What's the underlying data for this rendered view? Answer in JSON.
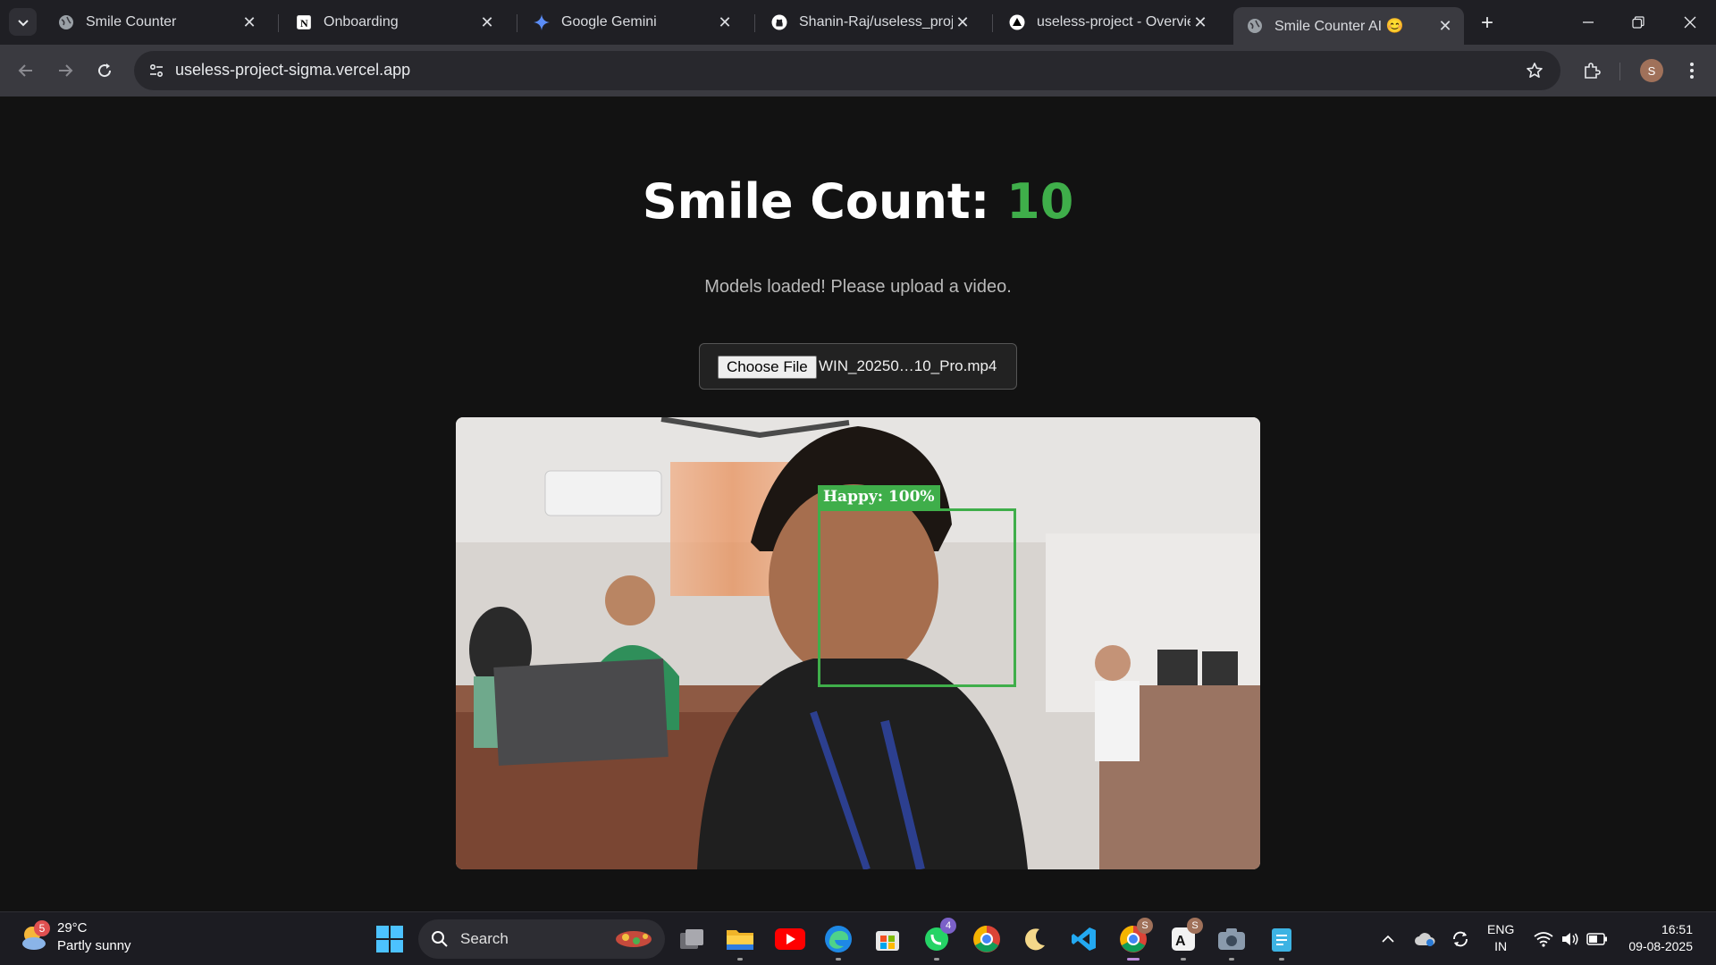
{
  "browser": {
    "tabs": [
      {
        "title": "Smile Counter",
        "icon": "globe-icon"
      },
      {
        "title": "Onboarding",
        "icon": "notion-icon"
      },
      {
        "title": "Google Gemini",
        "icon": "gemini-icon"
      },
      {
        "title": "Shanin-Raj/useless_project",
        "icon": "github-icon"
      },
      {
        "title": "useless-project - Overview",
        "icon": "vercel-icon"
      },
      {
        "title": "Smile Counter AI 😊",
        "icon": "globe-icon",
        "active": true
      }
    ],
    "url": "useless-project-sigma.vercel.app",
    "profile_initial": "S"
  },
  "page": {
    "heading_label": "Smile Count:",
    "smile_count": "10",
    "status": "Models loaded! Please upload a video.",
    "file_input": {
      "button_label": "Choose File",
      "file_name": "WIN_20250…10_Pro.mp4"
    },
    "detection": {
      "label": "Happy: 100%",
      "color": "#3fae4a"
    }
  },
  "taskbar": {
    "weather": {
      "temp": "29°C",
      "condition": "Partly sunny",
      "badge": "5"
    },
    "search_label": "Search",
    "whatsapp_badge": "4",
    "chrome_badge": "S",
    "ai_badge": "S",
    "language": {
      "line1": "ENG",
      "line2": "IN"
    },
    "time": "16:51",
    "date": "09-08-2025"
  },
  "colors": {
    "accent_green": "#3fae4a",
    "background": "#121212",
    "chrome_dark": "#1f1f24",
    "toolbar": "#3a3a40"
  }
}
